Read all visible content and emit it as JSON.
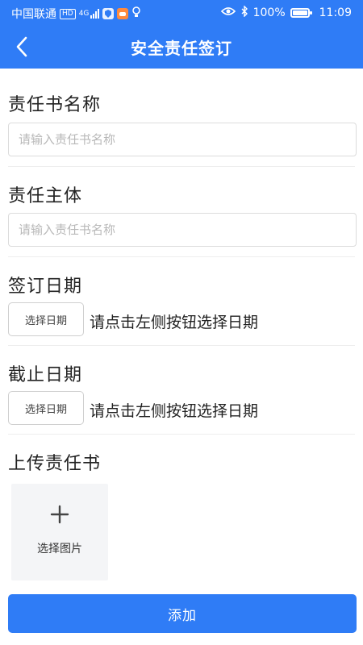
{
  "status_bar": {
    "carrier": "中国联通",
    "hd_badge": "HD",
    "network": "4G",
    "battery": "100%",
    "time": "11:09"
  },
  "header": {
    "title": "安全责任签订"
  },
  "form": {
    "name_section": {
      "label": "责任书名称",
      "placeholder": "请输入责任书名称"
    },
    "subject_section": {
      "label": "责任主体",
      "placeholder": "请输入责任书名称"
    },
    "sign_date_section": {
      "label": "签订日期",
      "button_label": "选择日期",
      "hint": "请点击左侧按钮选择日期"
    },
    "deadline_section": {
      "label": "截止日期",
      "button_label": "选择日期",
      "hint": "请点击左侧按钮选择日期"
    },
    "upload_section": {
      "label": "上传责任书",
      "upload_label": "选择图片"
    }
  },
  "submit": {
    "label": "添加"
  },
  "colors": {
    "primary": "#2f7cf6",
    "divider": "#eeeeee",
    "upload_bg": "#f4f5f7"
  },
  "icons": {
    "back": "chevron-left-icon",
    "upload": "plus-icon",
    "eye": "eye-icon",
    "bluetooth": "bluetooth-icon",
    "battery": "battery-icon"
  }
}
